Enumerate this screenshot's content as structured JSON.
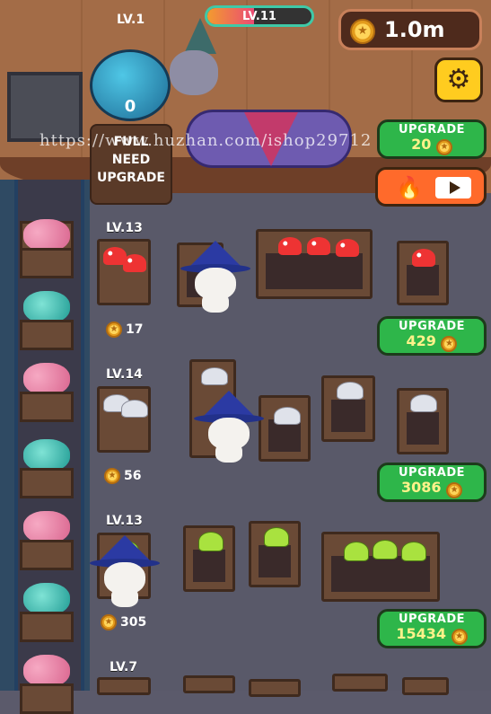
{
  "header": {
    "player_level": "LV.11",
    "xp_progress": 0.45,
    "coins": "1.0m",
    "settings_icon": "gear-icon"
  },
  "cauldron": {
    "level": "LV.1",
    "count": "0",
    "status_line1": "FULL",
    "status_line2": "NEED",
    "status_line3": "UPGRADE",
    "upgrade_label": "UPGRADE",
    "upgrade_cost": "20"
  },
  "boost": {
    "fire_icon": "fire-icon",
    "video_icon": "video-ad-icon"
  },
  "rows": [
    {
      "level": "LV.13",
      "earning": "17",
      "upgrade_label": "UPGRADE",
      "upgrade_cost": "429",
      "item": "red-mushroom"
    },
    {
      "level": "LV.14",
      "earning": "56",
      "upgrade_label": "UPGRADE",
      "upgrade_cost": "3086",
      "item": "white-mushroom"
    },
    {
      "level": "LV.13",
      "earning": "305",
      "upgrade_label": "UPGRADE",
      "upgrade_cost": "15434",
      "item": "green-mushroom"
    },
    {
      "level": "LV.7"
    }
  ],
  "watermark": "https://www.huzhan.com/ishop29712",
  "colors": {
    "upgrade_green": "#2eb64a",
    "boost_orange": "#ff6a2b",
    "coin_gold": "#ffd55a",
    "gear_yellow": "#ffcc1f"
  }
}
